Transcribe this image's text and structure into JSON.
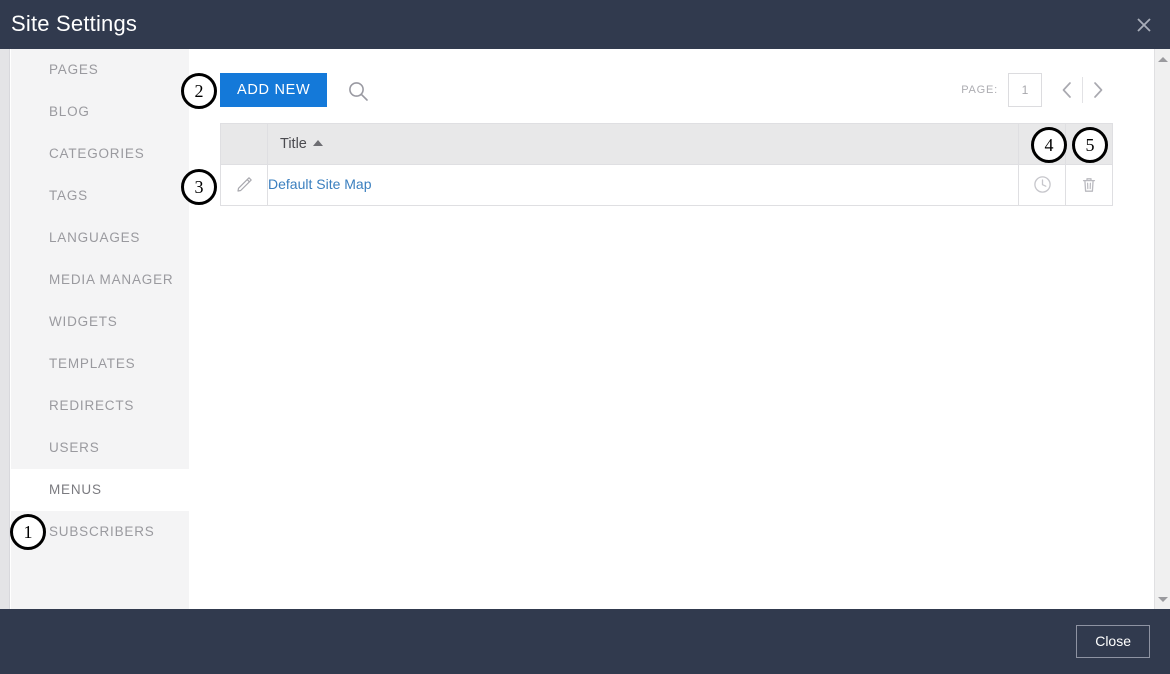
{
  "window": {
    "title": "Site Settings",
    "close_icon": "close-x-icon"
  },
  "sidebar": {
    "items": [
      {
        "label": "PAGES",
        "active": false
      },
      {
        "label": "BLOG",
        "active": false
      },
      {
        "label": "CATEGORIES",
        "active": false
      },
      {
        "label": "TAGS",
        "active": false
      },
      {
        "label": "LANGUAGES",
        "active": false
      },
      {
        "label": "MEDIA MANAGER",
        "active": false
      },
      {
        "label": "WIDGETS",
        "active": false
      },
      {
        "label": "TEMPLATES",
        "active": false
      },
      {
        "label": "REDIRECTS",
        "active": false
      },
      {
        "label": "USERS",
        "active": false
      },
      {
        "label": "MENUS",
        "active": true
      },
      {
        "label": "SUBSCRIBERS",
        "active": false
      }
    ]
  },
  "toolbar": {
    "add_new_label": "ADD NEW",
    "search_icon": "search-icon"
  },
  "pager": {
    "label": "PAGE:",
    "value": "1",
    "prev_icon": "chevron-left-icon",
    "next_icon": "chevron-right-icon"
  },
  "table": {
    "columns": [
      {
        "key": "edit",
        "label": ""
      },
      {
        "key": "title",
        "label": "Title",
        "sorted": "asc"
      },
      {
        "key": "history",
        "label": ""
      },
      {
        "key": "delete",
        "label": ""
      }
    ],
    "rows": [
      {
        "edit_icon": "pencil-icon",
        "title": "Default Site Map",
        "history_icon": "clock-icon",
        "delete_icon": "trash-icon"
      }
    ]
  },
  "footer": {
    "close_label": "Close"
  },
  "callouts": [
    {
      "number": "1",
      "target": "sidebar-item-menus"
    },
    {
      "number": "2",
      "target": "add-new-button"
    },
    {
      "number": "3",
      "target": "row-edit-button"
    },
    {
      "number": "4",
      "target": "row-history-button"
    },
    {
      "number": "5",
      "target": "row-delete-button"
    }
  ],
  "colors": {
    "chrome": "#313a4e",
    "accent": "#1479d9",
    "link": "#3a7fbf",
    "sidebar_bg": "#f4f4f5",
    "table_header_bg": "#e8e8e9"
  }
}
